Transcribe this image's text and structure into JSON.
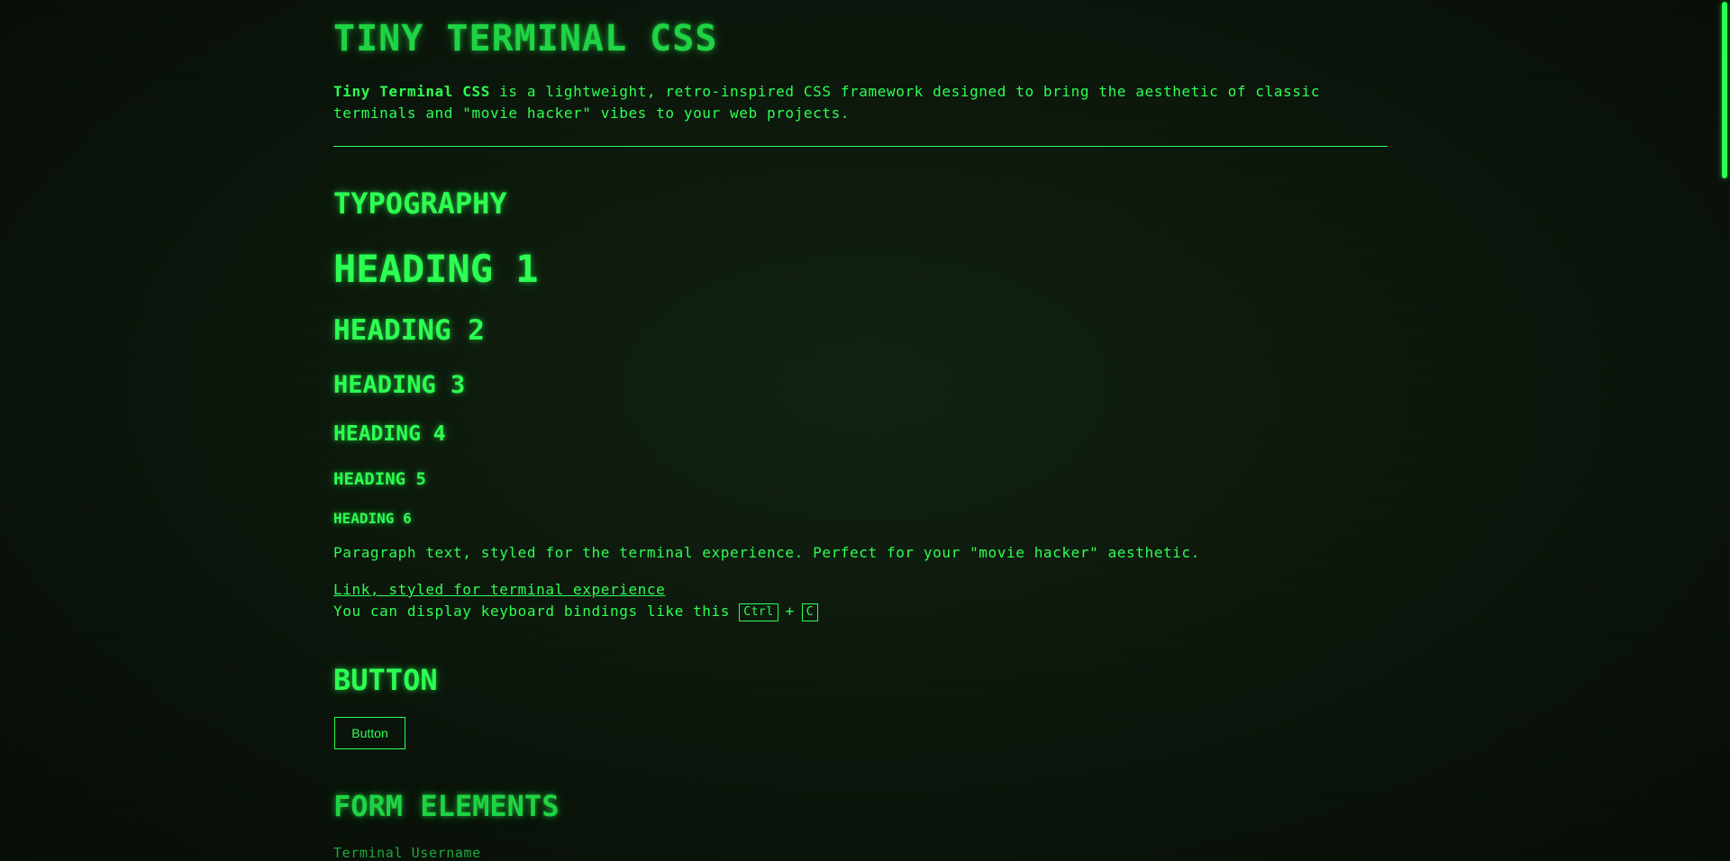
{
  "header": {
    "title": "TINY TERMINAL CSS",
    "intro_strong": "Tiny Terminal CSS",
    "intro_rest_line1": " is a lightweight, retro-inspired CSS framework designed to bring the aesthetic of classic",
    "intro_rest_line2": "terminals and \"movie hacker\" vibes to your web projects."
  },
  "typography": {
    "section_title": "TYPOGRAPHY",
    "h1": "HEADING 1",
    "h2": "HEADING 2",
    "h3": "HEADING 3",
    "h4": "HEADING 4",
    "h5": "HEADING 5",
    "h6": "HEADING 6",
    "paragraph": "Paragraph text, styled for the terminal experience. Perfect for your \"movie hacker\" aesthetic.",
    "link": "Link, styled for terminal experience",
    "kbd_prefix": "You can display keyboard bindings like this ",
    "kbd_key1": "Ctrl",
    "kbd_plus": "+",
    "kbd_key2": "C"
  },
  "button_section": {
    "section_title": "BUTTON",
    "button_label": "Button"
  },
  "form_section": {
    "section_title": "FORM ELEMENTS",
    "username_label": "Terminal Username"
  },
  "colors": {
    "accent": "#2dff52",
    "background": "#0d190d"
  }
}
